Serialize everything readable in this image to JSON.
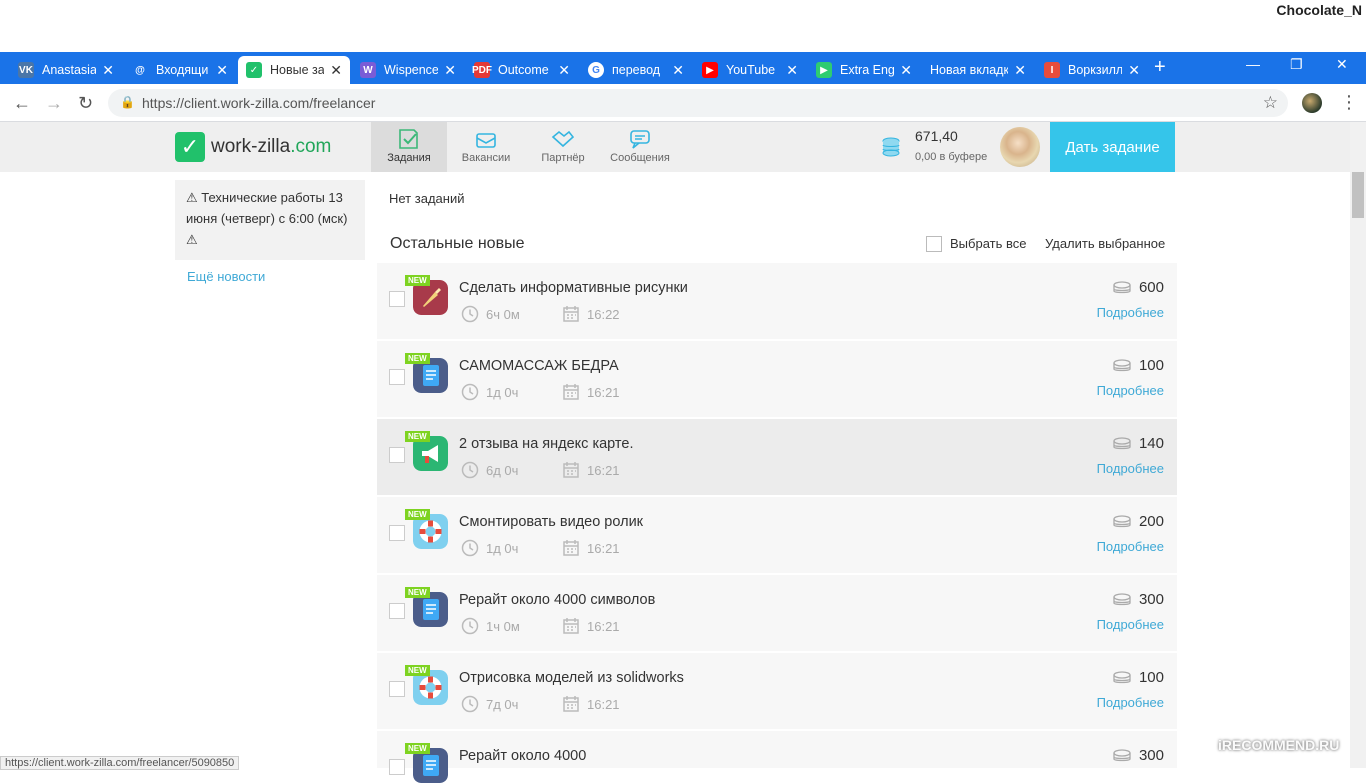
{
  "top": {
    "user": "Chocolate_N"
  },
  "tabs": [
    {
      "label": "Anastasia",
      "icon": "vk-icon",
      "color": "#4a76a8",
      "glyph": "VK"
    },
    {
      "label": "Входящи",
      "icon": "mail-at-icon",
      "color": "#1a73e8",
      "glyph": "@"
    },
    {
      "label": "Новые за",
      "icon": "workzilla-icon",
      "color": "#21c16b",
      "glyph": "✓",
      "active": true
    },
    {
      "label": "Wispence",
      "icon": "wispence-icon",
      "color": "#7a5cd6",
      "glyph": "W"
    },
    {
      "label": "Outcome",
      "icon": "pdf-icon",
      "color": "#e53935",
      "glyph": "PDF"
    },
    {
      "label": "перевод",
      "icon": "google-icon",
      "color": "#ffffff",
      "glyph": "G"
    },
    {
      "label": "YouTube",
      "icon": "youtube-icon",
      "color": "#ff0000",
      "glyph": "▶"
    },
    {
      "label": "Extra Eng",
      "icon": "play-icon",
      "color": "#2ecc71",
      "glyph": "▶"
    },
    {
      "label": "Новая вкладк",
      "icon": "none",
      "color": "",
      "glyph": ""
    },
    {
      "label": "Воркзилл",
      "icon": "workzilla-red-icon",
      "color": "#e74c3c",
      "glyph": "I"
    }
  ],
  "address": {
    "url": "https://client.work-zilla.com/freelancer"
  },
  "header": {
    "logo_text": "work-zilla",
    "logo_tld": ".com",
    "nav": [
      {
        "label": "Задания",
        "active": true
      },
      {
        "label": "Вакансии"
      },
      {
        "label": "Партнёр"
      },
      {
        "label": "Сообщения"
      }
    ],
    "balance": "671,40",
    "buffer": "0,00 в буфере",
    "give_task": "Дать задание"
  },
  "sidebar": {
    "news": "⚠ Технические работы 13 июня (четверг) с 6:00 (мск) ⚠",
    "more_news": "Ещё новости"
  },
  "main": {
    "no_tasks": "Нет заданий",
    "section_title": "Остальные новые",
    "select_all": "Выбрать все",
    "delete_selected": "Удалить выбранное",
    "badge": "NEW",
    "details": "Подробнее",
    "tasks": [
      {
        "title": "Сделать информативные рисунки",
        "duration": "6ч 0м",
        "time": "16:22",
        "price": "600",
        "icon": "brush-icon"
      },
      {
        "title": "САМОМАССАЖ БЕДРА",
        "duration": "1д 0ч",
        "time": "16:21",
        "price": "100",
        "icon": "document-icon"
      },
      {
        "title": "2 отзыва на яндекс карте.",
        "duration": "6д 0ч",
        "time": "16:21",
        "price": "140",
        "icon": "megaphone-icon"
      },
      {
        "title": "Смонтировать видео ролик",
        "duration": "1д 0ч",
        "time": "16:21",
        "price": "200",
        "icon": "lifebuoy-icon"
      },
      {
        "title": "Рерайт около 4000 символов",
        "duration": "1ч 0м",
        "time": "16:21",
        "price": "300",
        "icon": "document-icon"
      },
      {
        "title": "Отрисовка моделей из solidworks",
        "duration": "7д 0ч",
        "time": "16:21",
        "price": "100",
        "icon": "lifebuoy-icon"
      },
      {
        "title": "Рерайт около 4000",
        "duration": "",
        "time": "",
        "price": "300",
        "icon": "document-icon"
      }
    ]
  },
  "status_url": "https://client.work-zilla.com/freelancer/5090850",
  "watermark": "iRECOMMEND.RU"
}
